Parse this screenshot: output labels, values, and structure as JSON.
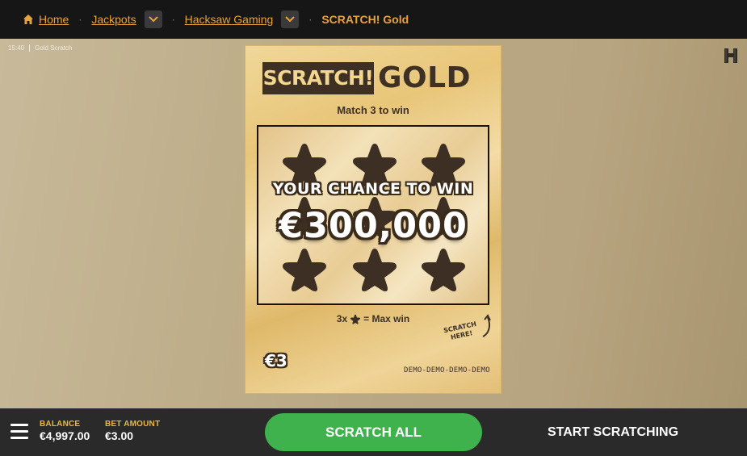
{
  "breadcrumb": {
    "home_label": "Home",
    "jackpots_label": "Jackpots",
    "provider_label": "Hacksaw Gaming",
    "current_label": "SCRATCH! Gold",
    "separator": "·"
  },
  "hud": {
    "time": "15:40",
    "game_name": "Gold Scratch",
    "provider_logo": "hacksaw-h-logo"
  },
  "ticket": {
    "logo_scratch": "SCRATCH!",
    "logo_gold": "GOLD",
    "instruction": "Match 3 to win",
    "chance_text": "YOUR CHANCE TO WIN",
    "jackpot_amount": "€300,000",
    "max_win_prefix": "3x",
    "max_win_suffix": "= Max win",
    "scratch_here_line1": "SCRATCH",
    "scratch_here_line2": "HERE!",
    "price": "€3",
    "demo_label": "DEMO-DEMO-DEMO-DEMO",
    "star_count": 9
  },
  "footer": {
    "balance_label": "BALANCE",
    "balance_value": "€4,997.00",
    "bet_label": "BET AMOUNT",
    "bet_value": "€3.00",
    "scratch_all_label": "SCRATCH ALL",
    "start_label": "START SCRATCHING"
  },
  "colors": {
    "accent": "#e8a33b",
    "primary_button": "#3fb24d",
    "ticket_dark": "#3e3124",
    "stat_label": "#f0b63a"
  },
  "icons": [
    "home-icon",
    "chevron-down-icon",
    "star-icon",
    "menu-icon",
    "hacksaw-logo-icon",
    "arrow-icon"
  ]
}
